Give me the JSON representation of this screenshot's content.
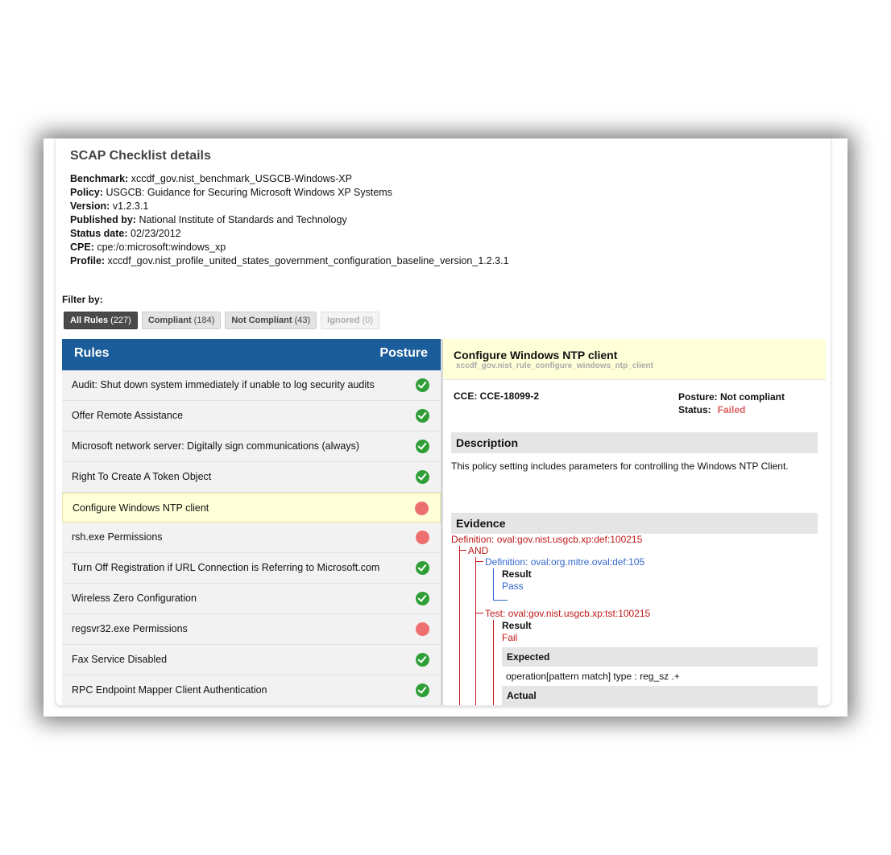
{
  "header": {
    "title": "SCAP Checklist details"
  },
  "meta": [
    {
      "key": "Benchmark:",
      "value": "xccdf_gov.nist_benchmark_USGCB-Windows-XP"
    },
    {
      "key": "Policy:",
      "value": "USGCB: Guidance for Securing Microsoft Windows XP Systems"
    },
    {
      "key": "Version:",
      "value": "v1.2.3.1"
    },
    {
      "key": "Published by:",
      "value": "National Institute of Standards and Technology"
    },
    {
      "key": "Status date:",
      "value": "02/23/2012"
    },
    {
      "key": "CPE:",
      "value": "cpe:/o:microsoft:windows_xp"
    },
    {
      "key": "Profile:",
      "value": "xccdf_gov.nist_profile_united_states_government_configuration_baseline_version_1.2.3.1"
    }
  ],
  "filter": {
    "label": "Filter by:",
    "buttons": [
      {
        "label": "All Rules",
        "count": "(227)"
      },
      {
        "label": "Compliant",
        "count": "(184)"
      },
      {
        "label": "Not Compliant",
        "count": "(43)"
      },
      {
        "label": "Ignored",
        "count": "(0)"
      }
    ]
  },
  "rules": {
    "col_rules": "Rules",
    "col_posture": "Posture",
    "items": [
      {
        "label": "Audit: Shut down system immediately if unable to log security audits",
        "status": "pass"
      },
      {
        "label": "Offer Remote Assistance",
        "status": "pass"
      },
      {
        "label": "Microsoft network server: Digitally sign communications (always)",
        "status": "pass"
      },
      {
        "label": "Right To Create A Token Object",
        "status": "pass"
      },
      {
        "label": "Configure Windows NTP client",
        "status": "fail"
      },
      {
        "label": "rsh.exe Permissions",
        "status": "fail"
      },
      {
        "label": "Turn Off Registration if URL Connection is Referring to Microsoft.com",
        "status": "pass"
      },
      {
        "label": "Wireless Zero Configuration",
        "status": "pass"
      },
      {
        "label": "regsvr32.exe Permissions",
        "status": "fail"
      },
      {
        "label": "Fax Service Disabled",
        "status": "pass"
      },
      {
        "label": "RPC Endpoint Mapper Client Authentication",
        "status": "pass"
      }
    ]
  },
  "detail": {
    "title": "Configure Windows NTP client",
    "rule_id": "xccdf_gov.nist_rule_configure_windows_ntp_client",
    "cce": "CCE: CCE-18099-2",
    "posture": "Posture: Not compliant",
    "status_label": "Status:",
    "status_value": "Failed",
    "description_header": "Description",
    "description": "This policy setting includes parameters for controlling the Windows NTP Client.",
    "evidence_header": "Evidence",
    "evidence": {
      "def1": "Definition: oval:gov.nist.usgcb.xp:def:100215",
      "op": "AND",
      "def2": "Definition: oval:org.mitre.oval:def:105",
      "result_label": "Result",
      "result_pass": "Pass",
      "test": "Test: oval:gov.nist.usgcb.xp:tst:100215",
      "result_label2": "Result",
      "result_fail": "Fail",
      "expected_header": "Expected",
      "expected_value": "operation[pattern match] type : reg_sz .+",
      "actual_header": "Actual"
    }
  },
  "colors": {
    "header_blue": "#1b5c9a",
    "pass_green": "#2f9e36",
    "fail_red": "#ee6f6f",
    "selected_yellow": "#ffffd8",
    "evidence_red": "#c01818",
    "evidence_blue": "#3366cc"
  },
  "icons": {
    "pass": "check-circle-icon",
    "fail": "red-dot-icon"
  }
}
